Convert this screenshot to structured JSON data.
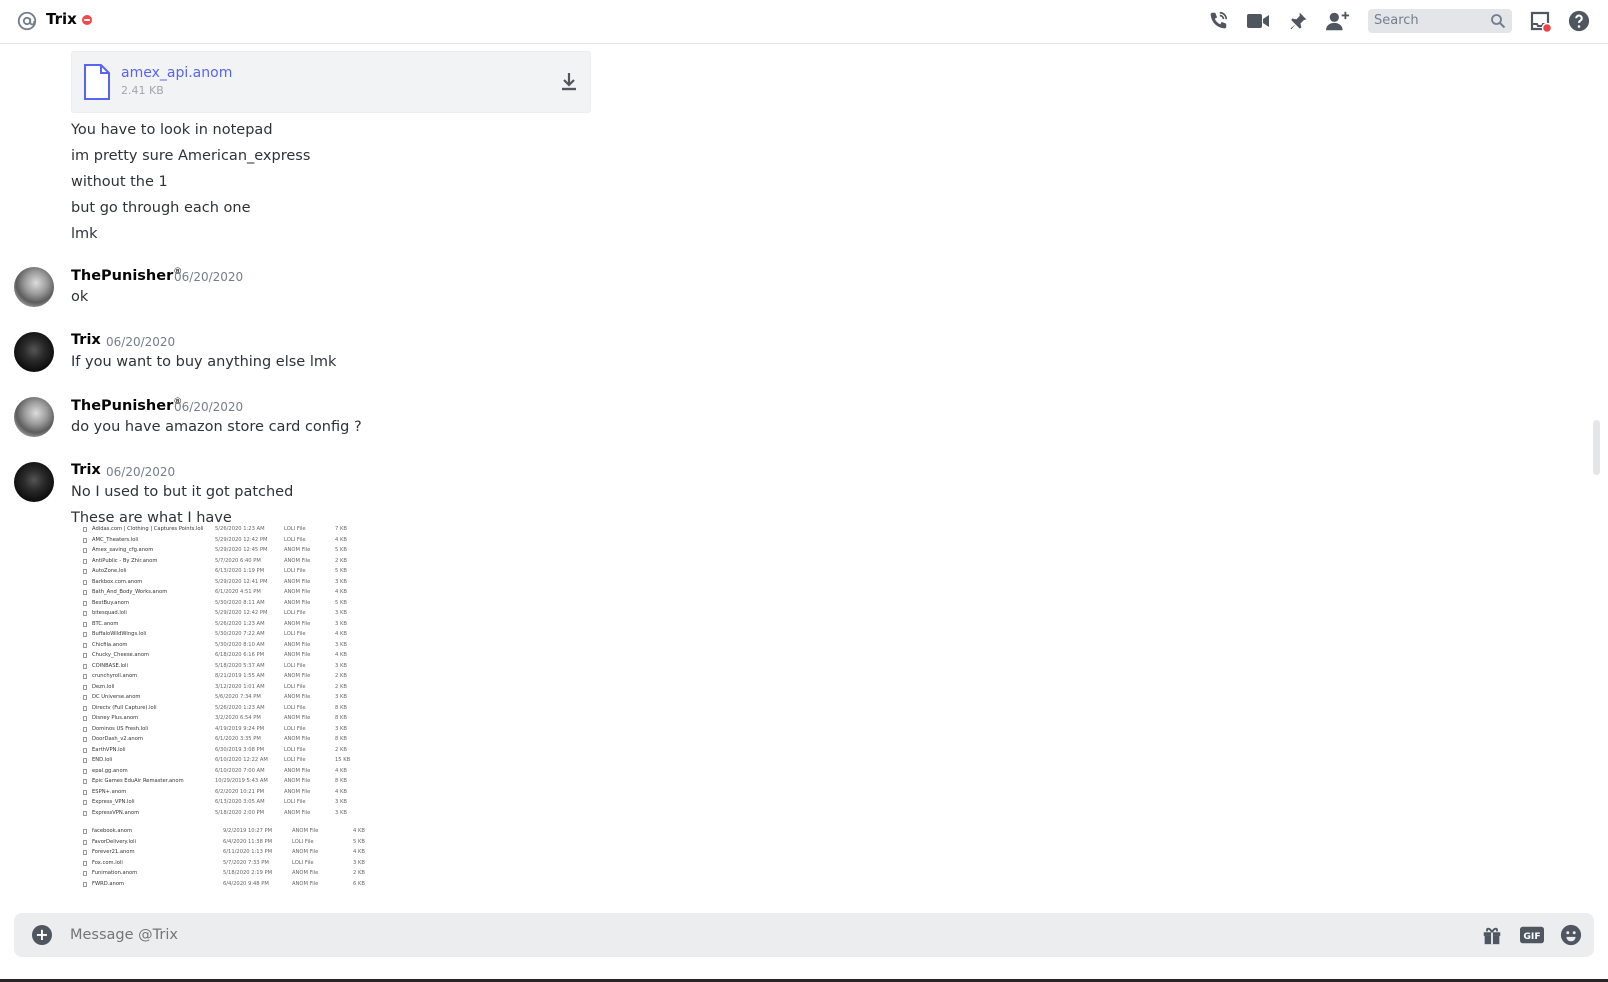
{
  "header": {
    "title": "Trix",
    "search_placeholder": "Search",
    "icons": [
      "at-icon",
      "voice-call-icon",
      "video-call-icon",
      "pin-icon",
      "add-friend-icon",
      "search-icon",
      "inbox-icon",
      "help-icon"
    ]
  },
  "attachment": {
    "filename": "amex_api.anom",
    "size": "2.41 KB"
  },
  "continuation_lines": [
    "You have to look in notepad",
    "im pretty sure American_express",
    "without the 1",
    "but go through each one",
    "lmk"
  ],
  "messages": [
    {
      "author": "ThePunisher",
      "badge": "®",
      "timestamp": "06/20/2020",
      "lines": [
        "ok"
      ]
    },
    {
      "author": "Trix",
      "badge": "",
      "timestamp": "06/20/2020",
      "lines": [
        "If you want to buy anything else lmk"
      ]
    },
    {
      "author": "ThePunisher",
      "badge": "®",
      "timestamp": "06/20/2020",
      "lines": [
        "do you have amazon store card config ?"
      ]
    },
    {
      "author": "Trix",
      "badge": "",
      "timestamp": "06/20/2020",
      "lines": [
        "No I used to but it got patched",
        "These are what I have"
      ]
    }
  ],
  "file_listing": [
    {
      "name": "Adidas.com | Clothing | Captures Points.loli",
      "date": "5/26/2020 1:23 AM",
      "type": "LOLI File",
      "size": "7 KB"
    },
    {
      "name": "AMC_Theaters.loli",
      "date": "5/29/2020 12:42 PM",
      "type": "LOLI File",
      "size": "4 KB"
    },
    {
      "name": "Amex_saving_cfg.anom",
      "date": "5/29/2020 12:45 PM",
      "type": "ANOM File",
      "size": "5 KB"
    },
    {
      "name": "AntiPublic - By Zhir.anom",
      "date": "5/7/2020 6:40 PM",
      "type": "ANOM File",
      "size": "2 KB"
    },
    {
      "name": "AutoZone.loli",
      "date": "6/13/2020 1:19 PM",
      "type": "LOLI File",
      "size": "5 KB"
    },
    {
      "name": "Barkbox.com.anom",
      "date": "5/29/2020 12:41 PM",
      "type": "ANOM File",
      "size": "3 KB"
    },
    {
      "name": "Bath_And_Body_Works.anom",
      "date": "6/1/2020 4:51 PM",
      "type": "ANOM File",
      "size": "4 KB"
    },
    {
      "name": "BestBuy.anom",
      "date": "5/30/2020 8:11 AM",
      "type": "ANOM File",
      "size": "5 KB"
    },
    {
      "name": "bitesquad.loli",
      "date": "5/29/2020 12:42 PM",
      "type": "LOLI File",
      "size": "3 KB"
    },
    {
      "name": "BTC.anom",
      "date": "5/26/2020 1:23 AM",
      "type": "ANOM File",
      "size": "3 KB"
    },
    {
      "name": "BuffaloWildWings.loli",
      "date": "5/30/2020 7:22 AM",
      "type": "LOLI File",
      "size": "4 KB"
    },
    {
      "name": "Chicfila.anom",
      "date": "5/30/2020 8:10 AM",
      "type": "ANOM File",
      "size": "3 KB"
    },
    {
      "name": "Chucky_Cheese.anom",
      "date": "6/18/2020 6:16 PM",
      "type": "ANOM File",
      "size": "4 KB"
    },
    {
      "name": "COINBASE.loli",
      "date": "5/18/2020 5:37 AM",
      "type": "LOLI File",
      "size": "3 KB"
    },
    {
      "name": "crunchyroll.anom",
      "date": "8/21/2019 1:55 AM",
      "type": "ANOM File",
      "size": "2 KB"
    },
    {
      "name": "Dezn.loli",
      "date": "3/12/2020 1:01 AM",
      "type": "LOLI File",
      "size": "2 KB"
    },
    {
      "name": "DC Universe.anom",
      "date": "5/6/2020 7:34 PM",
      "type": "ANOM File",
      "size": "3 KB"
    },
    {
      "name": "Directv (Full Capture).loli",
      "date": "5/26/2020 1:23 AM",
      "type": "LOLI File",
      "size": "8 KB"
    },
    {
      "name": "Disney Plus.anom",
      "date": "3/2/2020 6:54 PM",
      "type": "ANOM File",
      "size": "8 KB"
    },
    {
      "name": "Dominos US Fresh.loli",
      "date": "4/19/2019 9:24 PM",
      "type": "LOLI File",
      "size": "3 KB"
    },
    {
      "name": "DoorDash_v2.anom",
      "date": "6/1/2020 3:35 PM",
      "type": "ANOM File",
      "size": "8 KB"
    },
    {
      "name": "EarthVPN.loli",
      "date": "6/30/2019 3:08 PM",
      "type": "LOLI File",
      "size": "2 KB"
    },
    {
      "name": "END.loli",
      "date": "6/10/2020 12:22 AM",
      "type": "LOLI File",
      "size": "15 KB"
    },
    {
      "name": "epal.gg.anom",
      "date": "6/10/2020 7:00 AM",
      "type": "ANOM File",
      "size": "4 KB"
    },
    {
      "name": "Epic Games EduAir Remaster.anom",
      "date": "10/29/2019 5:43 AM",
      "type": "ANOM File",
      "size": "8 KB"
    },
    {
      "name": "ESPN+.anom",
      "date": "6/2/2020 10:21 PM",
      "type": "ANOM File",
      "size": "4 KB"
    },
    {
      "name": "Express_VPN.loli",
      "date": "6/13/2020 3:05 AM",
      "type": "LOLI File",
      "size": "3 KB"
    },
    {
      "name": "ExpressVPN.anom",
      "date": "5/18/2020 2:00 PM",
      "type": "ANOM File",
      "size": "3 KB"
    }
  ],
  "file_listing_2": [
    {
      "name": "facebook.anom",
      "date": "9/2/2019 10:27 PM",
      "type": "ANOM File",
      "size": "4 KB"
    },
    {
      "name": "FavorDelivery.loli",
      "date": "6/4/2020 11:38 PM",
      "type": "LOLI File",
      "size": "5 KB"
    },
    {
      "name": "Forever21.anom",
      "date": "6/11/2020 1:13 PM",
      "type": "ANOM File",
      "size": "4 KB"
    },
    {
      "name": "Fox.com.loli",
      "date": "5/7/2020 7:33 PM",
      "type": "LOLI File",
      "size": "3 KB"
    },
    {
      "name": "Funimation.anom",
      "date": "5/18/2020 2:19 PM",
      "type": "ANOM File",
      "size": "2 KB"
    },
    {
      "name": "FWRD.anom",
      "date": "6/4/2020 9:48 PM",
      "type": "ANOM File",
      "size": "6 KB"
    }
  ],
  "composer": {
    "placeholder": "Message @Trix",
    "icons": [
      "add-attachment-icon",
      "gift-icon",
      "gif-icon",
      "emoji-icon"
    ]
  }
}
